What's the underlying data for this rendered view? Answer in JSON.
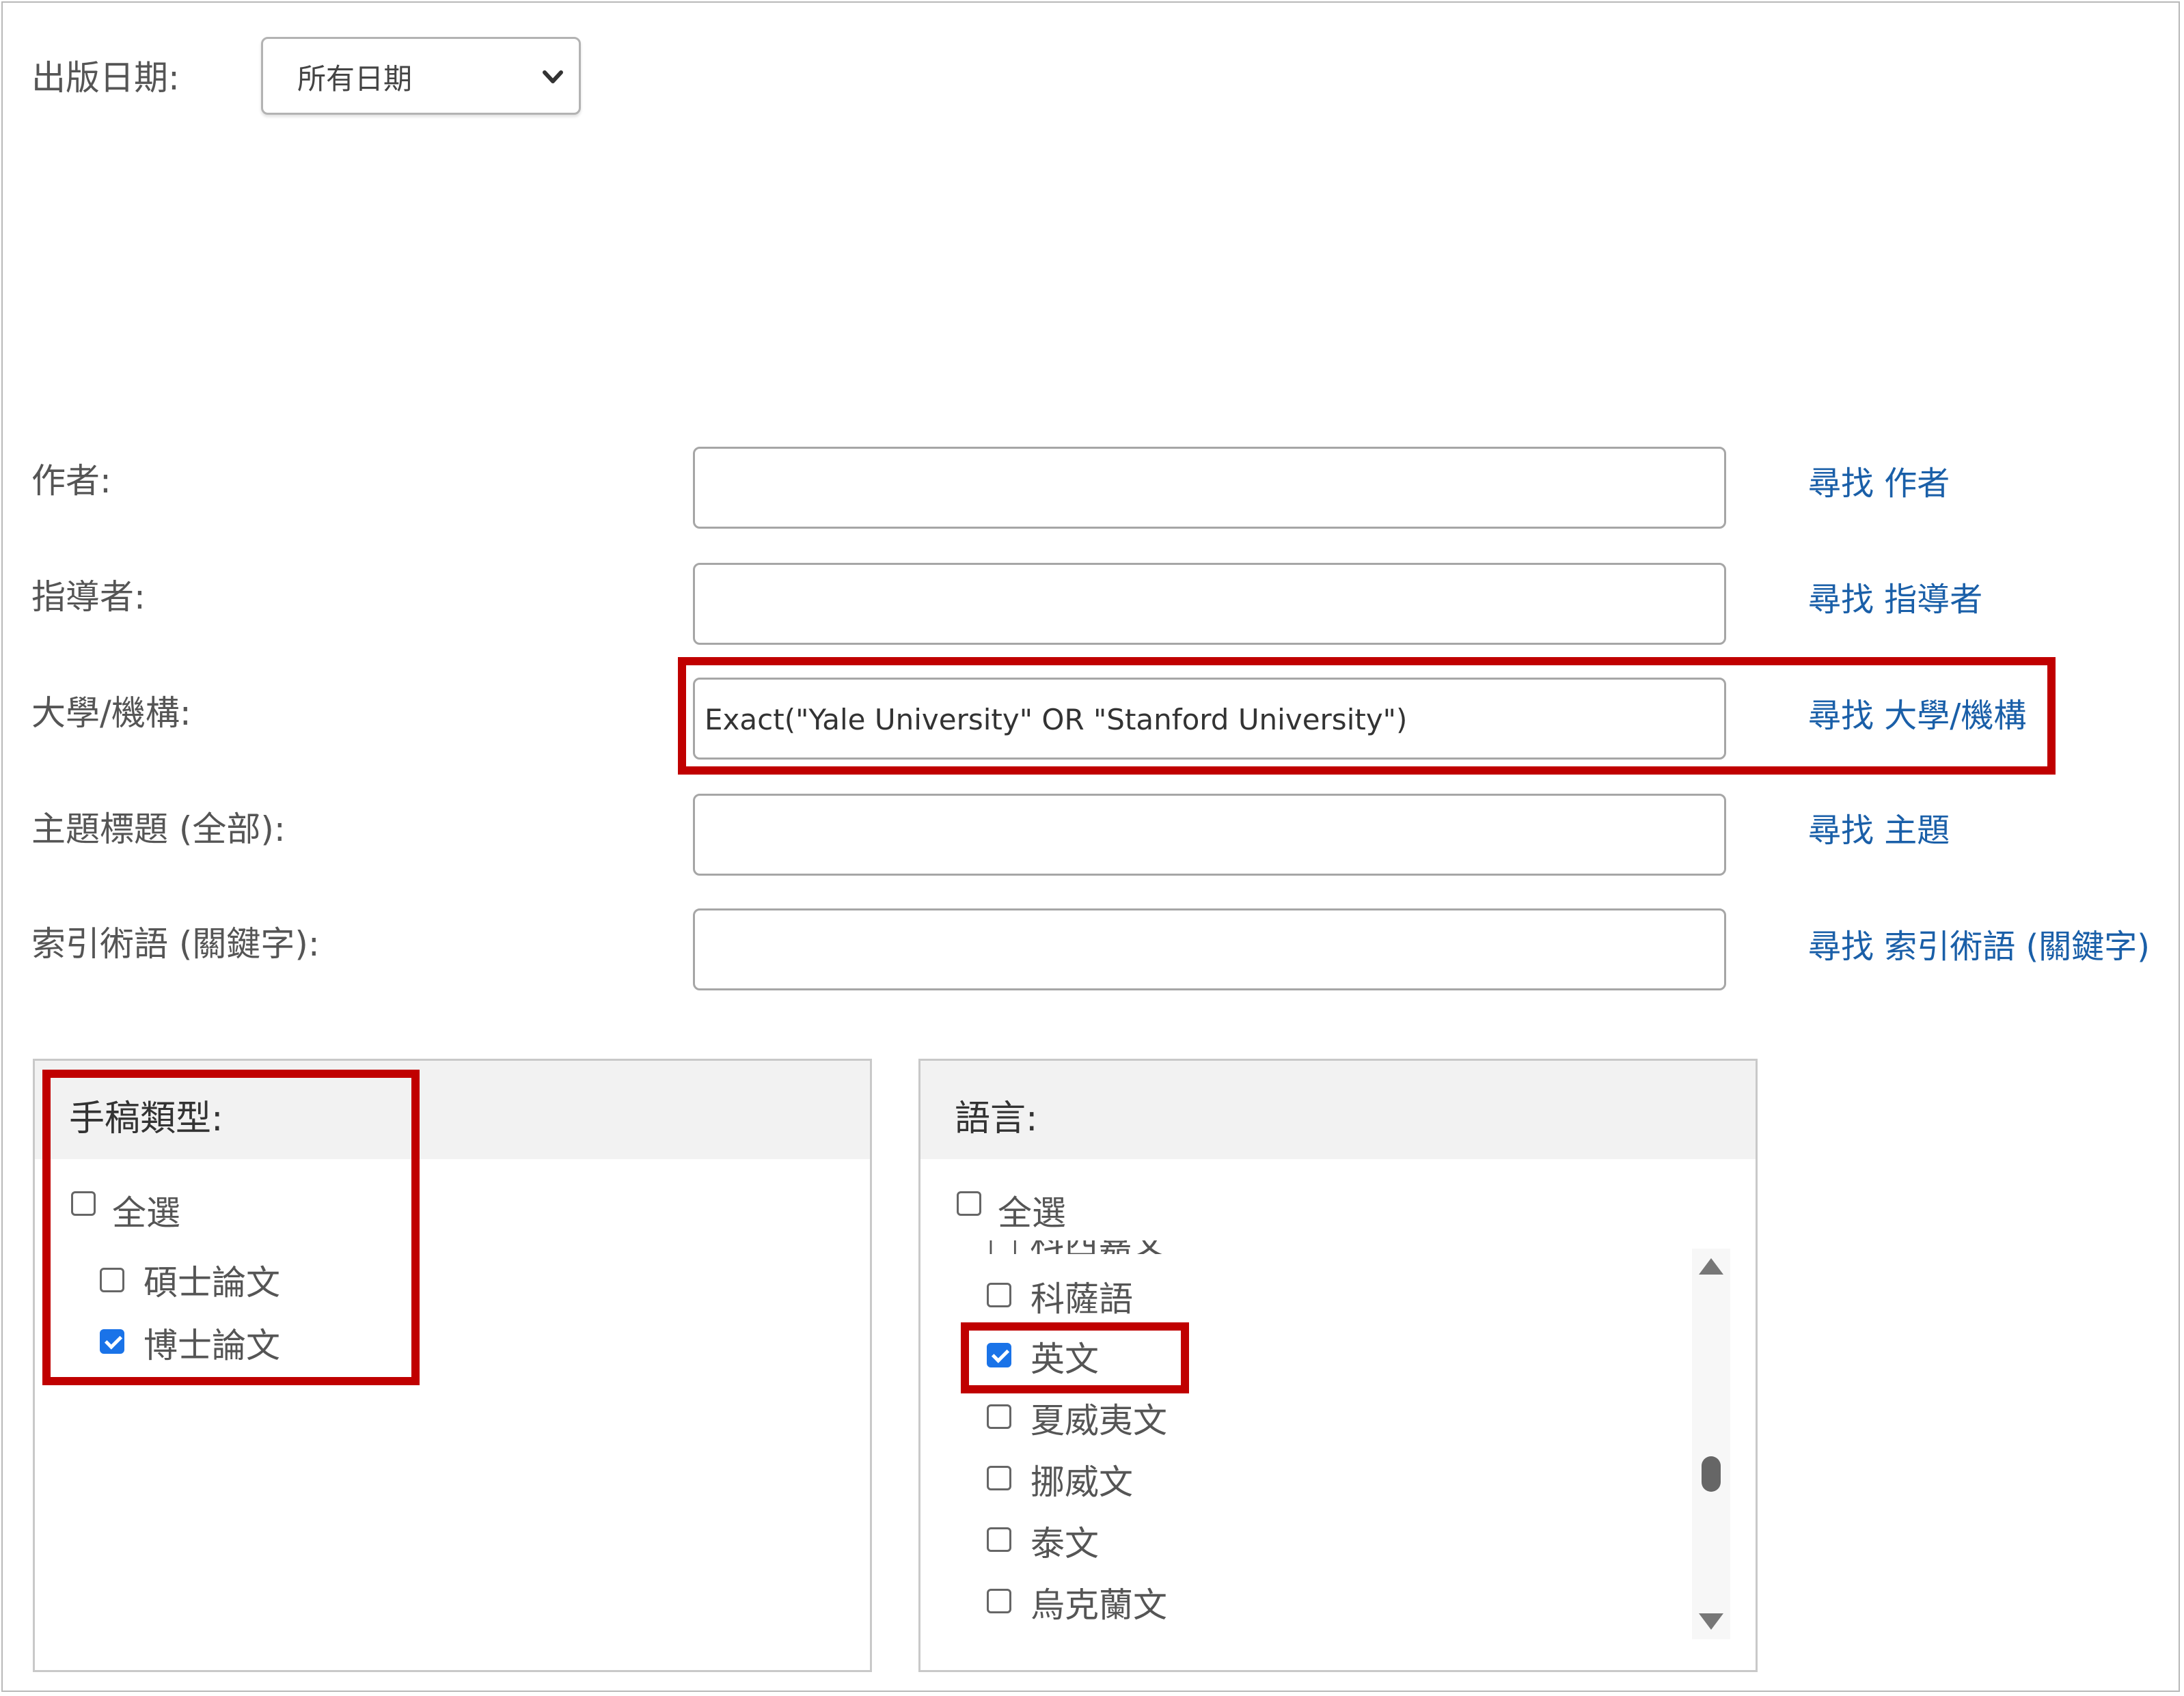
{
  "date": {
    "label": "出版日期:",
    "selected": "所有日期"
  },
  "fields": [
    {
      "label": "作者:",
      "value": "",
      "link": "尋找 作者"
    },
    {
      "label": "指導者:",
      "value": "",
      "link": "尋找 指導者"
    },
    {
      "label": "大學/機構:",
      "value": "Exact(\"Yale University\" OR \"Stanford University\")",
      "link": "尋找 大學/機構"
    },
    {
      "label": "主題標題 (全部):",
      "value": "",
      "link": "尋找 主題"
    },
    {
      "label": "索引術語 (關鍵字):",
      "value": "",
      "link": "尋找 索引術語 (關鍵字)"
    }
  ],
  "manuscript": {
    "title": "手稿類型:",
    "select_all": "全選",
    "options": [
      {
        "label": "碩士論文",
        "checked": false
      },
      {
        "label": "博士論文",
        "checked": true
      }
    ]
  },
  "language": {
    "title": "語言:",
    "select_all": "全選",
    "options": [
      {
        "label": "科薩語",
        "checked": false
      },
      {
        "label": "英文",
        "checked": true
      },
      {
        "label": "夏威夷文",
        "checked": false
      },
      {
        "label": "挪威文",
        "checked": false
      },
      {
        "label": "泰文",
        "checked": false
      },
      {
        "label": "烏克蘭文",
        "checked": false
      }
    ]
  },
  "colors": {
    "highlight": "#c00000",
    "link": "#1a5fa8",
    "checkbox_checked": "#1a73e8"
  }
}
